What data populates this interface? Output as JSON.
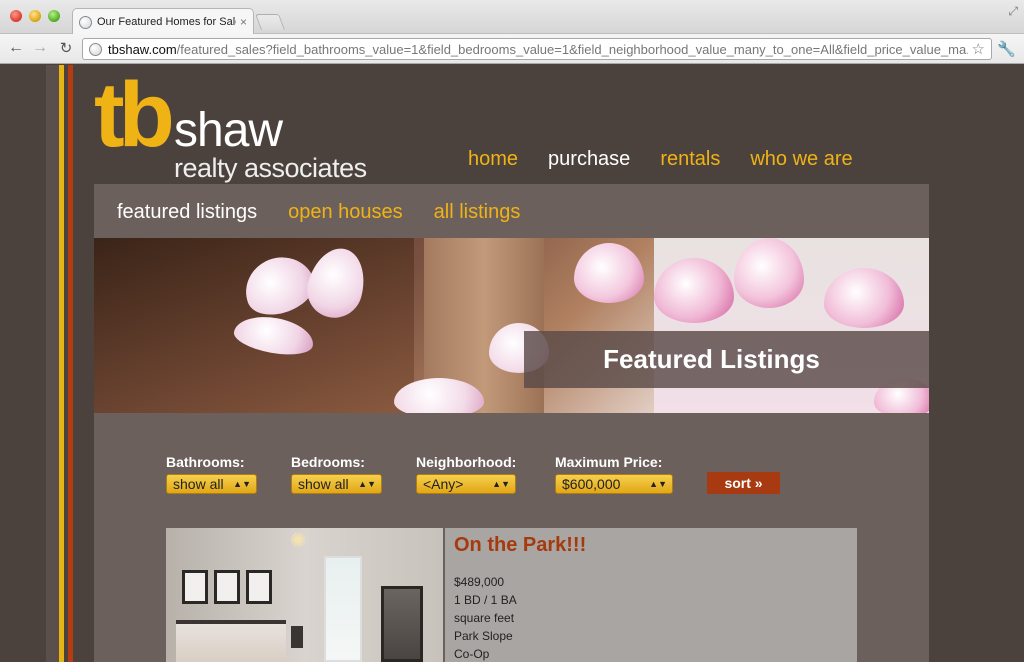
{
  "browser": {
    "tab_title": "Our Featured Homes for Sale",
    "tab_close": "×",
    "url_domain": "tbshaw.com",
    "url_path": "/featured_sales?field_bathrooms_value=1&field_bedrooms_value=1&field_neighborhood_value_many_to_one=All&field_price_value_ma...",
    "back": "←",
    "forward": "→",
    "reload": "↻",
    "star": "☆",
    "wrench": "🔧",
    "fullscreen": "⤢"
  },
  "logo": {
    "tb": "tb",
    "shaw": "shaw",
    "subtitle": "realty associates"
  },
  "main_nav": {
    "home": "home",
    "purchase": "purchase",
    "rentals": "rentals",
    "who_we_are": "who we are"
  },
  "sub_nav": {
    "featured": "featured listings",
    "open_houses": "open houses",
    "all_listings": "all listings"
  },
  "hero": {
    "caption": "Featured Listings"
  },
  "filters": {
    "bathrooms": {
      "label": "Bathrooms:",
      "value": "show all"
    },
    "bedrooms": {
      "label": "Bedrooms:",
      "value": "show all"
    },
    "neighborhood": {
      "label": "Neighborhood:",
      "value": "<Any>"
    },
    "max_price": {
      "label": "Maximum Price:",
      "value": "$600,000"
    },
    "sort_label": "sort »",
    "arrows": "▲▼"
  },
  "listing": {
    "title": "On the Park!!!",
    "details": [
      "$489,000",
      "1 BD / 1 BA",
      "square feet",
      "Park Slope",
      "Co-Op"
    ]
  },
  "colors": {
    "accent_yellow": "#efb316",
    "accent_rust": "#a53a0f",
    "page_bg": "#4b413d",
    "content_bg": "#6b605c"
  },
  "icons": {
    "back": "back-arrow-icon",
    "forward": "forward-arrow-icon",
    "reload": "reload-icon",
    "globe": "globe-icon",
    "star": "bookmark-star-icon",
    "wrench": "wrench-icon",
    "close": "close-icon",
    "fullscreen": "fullscreen-icon"
  }
}
